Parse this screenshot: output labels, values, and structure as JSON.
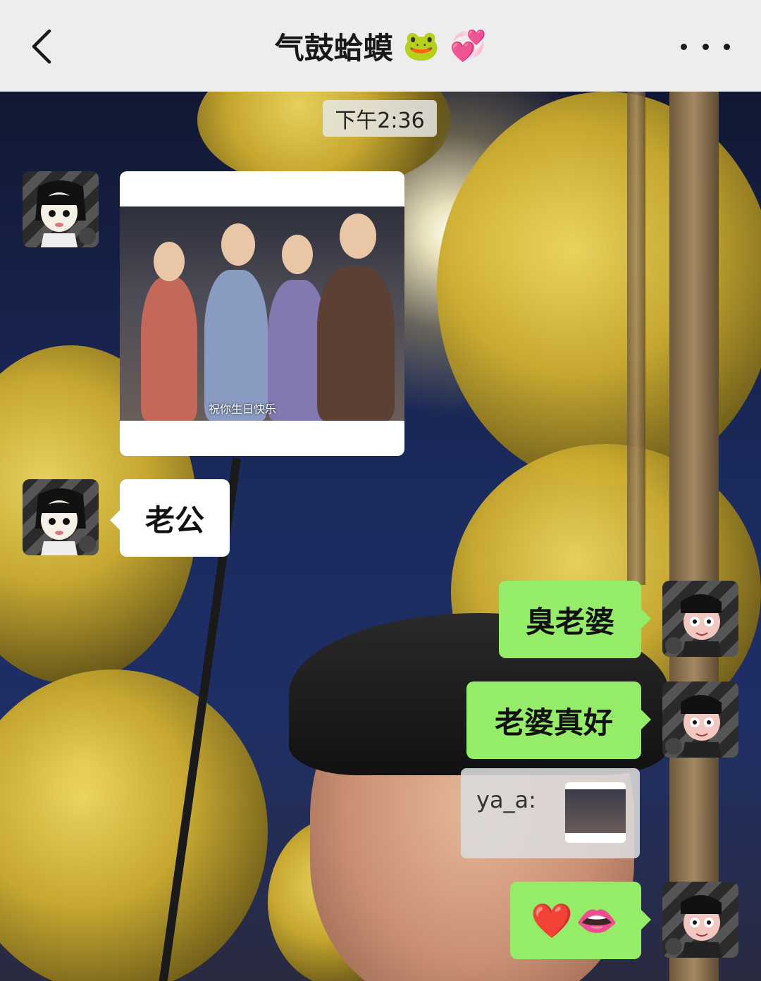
{
  "header": {
    "title": "气鼓蛤蟆",
    "title_emojis": [
      "🐸",
      "💞"
    ],
    "back_icon": "chevron-left-icon",
    "more_icon": "more-dots-icon"
  },
  "chat": {
    "timestamp": "下午2:36",
    "messages": [
      {
        "sender": "other",
        "type": "image",
        "caption": "祝你生日快乐"
      },
      {
        "sender": "other",
        "type": "text",
        "text": "老公"
      },
      {
        "sender": "self",
        "type": "text",
        "text": "臭老婆"
      },
      {
        "sender": "self",
        "type": "text",
        "text": "老婆真好"
      },
      {
        "sender": "self",
        "type": "quote",
        "text": "ya_a:"
      },
      {
        "sender": "self",
        "type": "emoji",
        "text": "❤️👄"
      }
    ]
  },
  "colors": {
    "header_bg": "#ededed",
    "self_bubble": "#95ec69",
    "other_bubble": "#ffffff"
  }
}
